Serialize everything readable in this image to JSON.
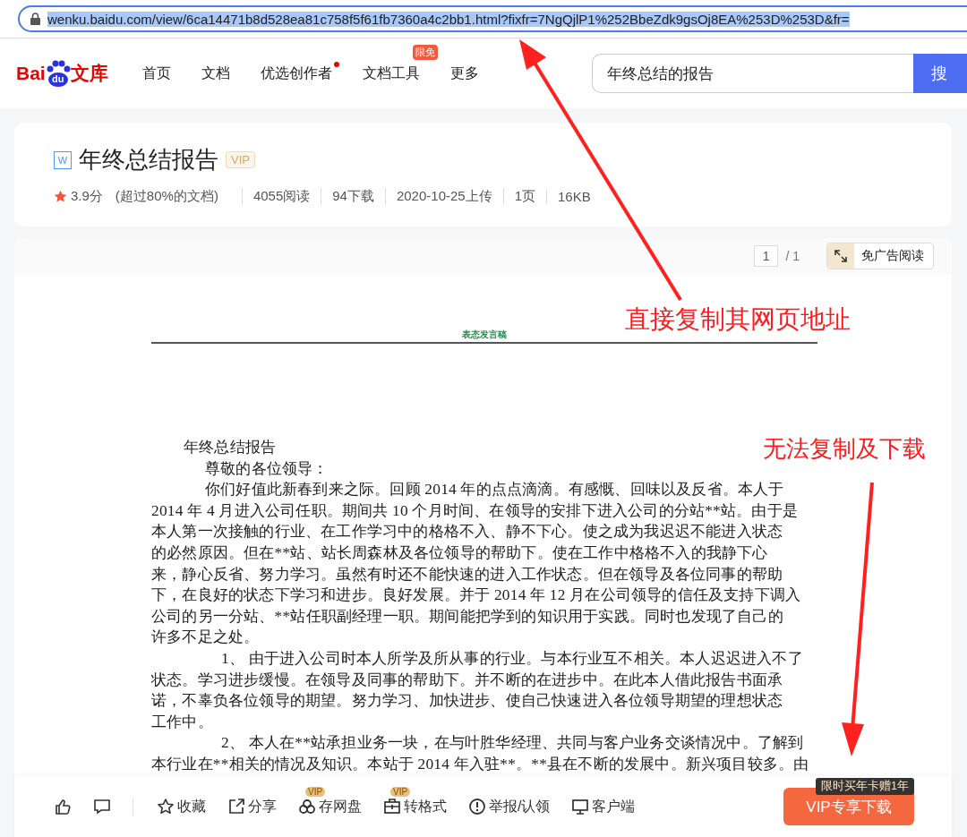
{
  "address_bar": {
    "url": "wenku.baidu.com/view/6ca14471b8d528ea81c758f5f61fb7360a4c2bb1.html?fixfr=7NgQjlP1%252BbeZdk9gsOj8EA%253D%253D&fr=",
    "selected": true
  },
  "logo": {
    "parts": [
      "Bai",
      "du",
      "文库"
    ]
  },
  "nav": [
    {
      "label": "首页",
      "dot": false
    },
    {
      "label": "文档",
      "dot": false
    },
    {
      "label": "优选创作者",
      "dot": true
    },
    {
      "label": "文档工具",
      "dot": false,
      "badge": "限免"
    },
    {
      "label": "更多",
      "dot": false
    }
  ],
  "search": {
    "value": "年终总结的报告",
    "button": "搜"
  },
  "doc_info": {
    "file_type": "W",
    "title": "年终总结报告",
    "badge": "VIP",
    "score": "3.9分",
    "score_note": "(超过80%的文档)",
    "stats": [
      "4055阅读",
      "94下载",
      "2020-10-25上传",
      "1页",
      "16KB"
    ]
  },
  "viewer": {
    "page": "1",
    "total": "/ 1",
    "ad_free_button": "免广告阅读"
  },
  "document": {
    "header": "表态发言稿",
    "paragraphs": [
      {
        "kind": "title",
        "lines": [
          "年终总结报告"
        ]
      },
      {
        "kind": "indent",
        "lines": [
          "尊敬的各位领导："
        ]
      },
      {
        "kind": "indent",
        "lines": [
          "你们好值此新春到来之际。回顾 2014 年的点点滴滴。有感慨、回味以及反省。本人于",
          "2014 年 4 月进入公司任职。期间共 10 个月时间、在领导的安排下进入公司的分站**站。由于是",
          "本人第一次接触的行业、在工作学习中的格格不入、静不下心。使之成为我迟迟不能进入状态",
          "的必然原因。但在**站、站长周森林及各位领导的帮助下。使在工作中格格不入的我静下心",
          "来，静心反省、努力学习。虽然有时还不能快速的进入工作状态。但在领导及各位同事的帮助",
          "下，在良好的状态下学习和进步。良好发展。并于 2014 年 12 月在公司领导的信任及支持下调入",
          "公司的另一分站、**站任职副经理一职。期间能把学到的知识用于实践。同时也发现了自己的",
          "许多不足之处。"
        ]
      },
      {
        "kind": "numbered",
        "lines": [
          "1、 由于进入公司时本人所学及所从事的行业。与本行业互不相关。本人迟迟进入不了",
          "状态。学习进步缓慢。在领导及同事的帮助下。并不断的在进步中。在此本人借此报告书面承",
          "诺，不辜负各位领导的期望。努力学习、加快进步、使自己快速进入各位领导期望的理想状态",
          "工作中。"
        ]
      },
      {
        "kind": "numbered",
        "lines": [
          "2、 本人在**站承担业务一块，在与叶胜华经理、共同与客户业务交谈情况中。了解到",
          "本行业在**相关的情况及知识。本站于 2014 年入驻**。**县在不断的发展中。新兴项目较多。由"
        ]
      }
    ]
  },
  "bottom_bar": {
    "actions": [
      {
        "kind": "like"
      },
      {
        "kind": "comment"
      },
      {
        "kind": "star",
        "label": "收藏"
      },
      {
        "kind": "share",
        "label": "分享"
      },
      {
        "kind": "cloud",
        "label": "存网盘",
        "badge": "VIP"
      },
      {
        "kind": "convert",
        "label": "转格式",
        "badge": "VIP"
      },
      {
        "kind": "report",
        "label": "举报/认领"
      },
      {
        "kind": "client",
        "label": "客户端"
      }
    ],
    "download": {
      "label": "VIP专享下载",
      "promo": "限时买年卡赠1年"
    }
  },
  "annotations": [
    {
      "kind": "url",
      "text": "直接复制其网页地址"
    },
    {
      "kind": "download",
      "text": "无法复制及下载"
    }
  ]
}
